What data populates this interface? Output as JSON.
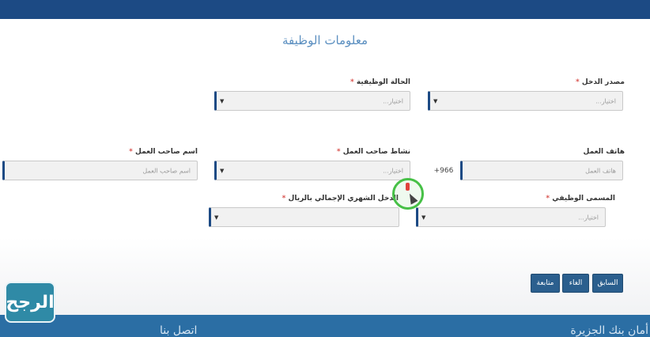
{
  "section_title": "معلومات الوظيفة",
  "fields": {
    "income_source": {
      "label": "مصدر الدخل",
      "required": "*",
      "placeholder": "اختيار..."
    },
    "employment_status": {
      "label": "الحالة الوظيفية",
      "required": "*",
      "placeholder": "اختيار..."
    },
    "work_phone": {
      "label": "هاتف العمل",
      "prefix": "+966",
      "placeholder": "هاتف العمل"
    },
    "employer_activity": {
      "label": "نشاط صاحب العمل",
      "required": "*",
      "placeholder": "اختيار..."
    },
    "employer_name": {
      "label": "اسم صاحب العمل",
      "required": "*",
      "placeholder": "اسم صاحب العمل"
    },
    "job_title": {
      "label": "المسمى الوظيفي",
      "required": "*",
      "placeholder": "اختيار..."
    },
    "monthly_income": {
      "label": "الدخل الشهري الإجمالي بالريال",
      "required": "*",
      "placeholder": ""
    }
  },
  "buttons": {
    "previous": "السابق",
    "cancel": "الغاء",
    "next": "متابعة"
  },
  "footer": {
    "right_text": "أمان بنك الجزيرة",
    "left_text": "اتصل بنا"
  },
  "logo_text": "الرجح",
  "icons": {
    "dropdown": "caret-down-icon",
    "cursor": "mouse-cursor-icon"
  },
  "colors": {
    "top_bar": "#1c4a84",
    "field_accent": "#1c4a84",
    "button": "#2b5f8e",
    "footer": "#2b6ea4",
    "required": "#d9534f"
  }
}
